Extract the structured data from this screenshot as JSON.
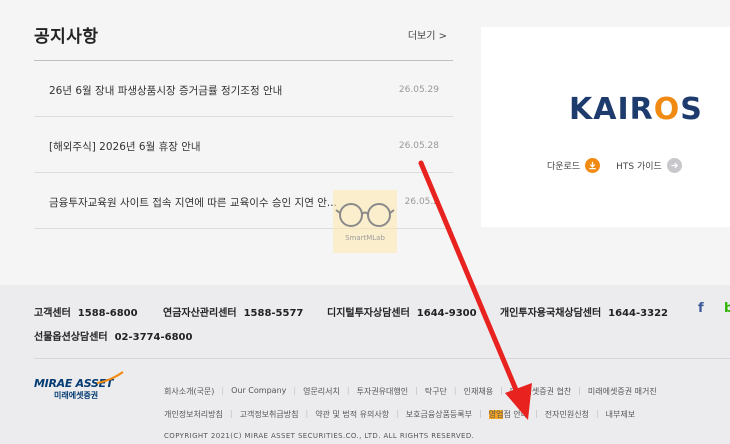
{
  "notice": {
    "title": "공지사항",
    "more": "더보기 >",
    "items": [
      {
        "text": "26년 6월 장내 파생상품시장 증거금률 정기조정 안내",
        "date": "26.05.29"
      },
      {
        "text": "[해외주식] 2026년 6월 휴장 안내",
        "date": "26.05.28"
      },
      {
        "text": "금융투자교육원 사이트 접속 지연에 따른 교육이수 승인 지연 안...",
        "date": "26.05.2"
      }
    ]
  },
  "kairos": {
    "logo_pre": "KAIR",
    "logo_o": "O",
    "logo_post": "S",
    "download_label": "다운로드",
    "hts_label": "HTS 가이드"
  },
  "watermark": {
    "text": "SmartMLab"
  },
  "footer": {
    "contacts": [
      {
        "label": "고객센터",
        "number": "1588-6800"
      },
      {
        "label": "연금자산관리센터",
        "number": "1588-5577"
      },
      {
        "label": "디지털투자상담센터",
        "number": "1644-9300"
      },
      {
        "label": "개인투자용국채상담센터",
        "number": "1644-3322"
      },
      {
        "label": "선물옵션상담센터",
        "number": "02-3774-6800"
      }
    ],
    "social_facebook": "f",
    "social_blog": "b",
    "logo_en": "MIRAE ASSET",
    "logo_kr": "미래에셋증권",
    "links_row1": [
      "회사소개(국문)",
      "Our Company",
      "영문리서치",
      "투자권유대행인",
      "탁구단",
      "인재채용",
      "미래에셋증권 협찬",
      "미래에셋증권 매거진"
    ],
    "links_row2": [
      {
        "text": "개인정보처리방침",
        "bold": true
      },
      {
        "text": "고객정보취급방침",
        "bold": false
      },
      {
        "text": "약관 및 법적 유의사항",
        "bold": false
      },
      {
        "text": "보호금융상품등록부",
        "bold": false
      }
    ],
    "link_highlight_part": "영업",
    "link_highlight_rest": "점 안내",
    "links_row2_tail": [
      "전자민원신청",
      "내부제보"
    ],
    "copyright": "COPYRIGHT 2021(C) MIRAE ASSET SECURITIES.CO., LTD. ALL RIGHTS RESERVED."
  },
  "colors": {
    "accent_orange": "#f08a12",
    "brand_navy": "#1e3b6d",
    "arrow_red": "#e8231f",
    "highlight": "#f6a623"
  }
}
